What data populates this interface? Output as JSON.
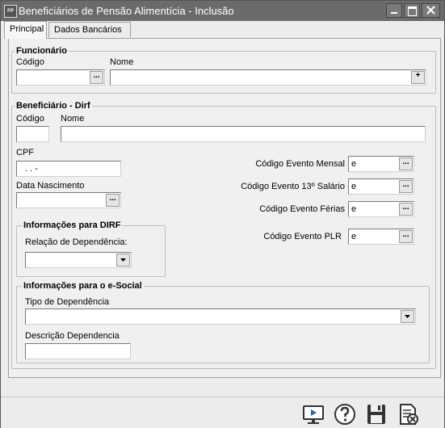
{
  "window": {
    "title": "Beneficiários de Pensão Alimentícia - Inclusão",
    "app_icon": "FP"
  },
  "tabs": [
    {
      "label": "Principal",
      "active": true
    },
    {
      "label": "Dados Bancários",
      "active": false
    }
  ],
  "funcionario": {
    "title": "Funcionário",
    "codigo_label": "Código",
    "nome_label": "Nome",
    "codigo_value": "",
    "nome_value": ""
  },
  "beneficiario": {
    "title": "Beneficiário - Dirf",
    "codigo_label": "Código",
    "nome_label": "Nome",
    "cpf_label": "CPF",
    "cpf_mask": ".   .   -",
    "nascimento_label": "Data Nascimento",
    "evento_mensal_label": "Código Evento Mensal",
    "evento_mensal_value": "e",
    "evento_13_label": "Código Evento 13º Salário",
    "evento_13_value": "e",
    "evento_ferias_label": "Código Evento Férias",
    "evento_ferias_value": "e",
    "evento_plr_label": "Código Evento PLR",
    "evento_plr_value": "e"
  },
  "dirf": {
    "title": "Informações para DIRF",
    "relacao_label": "Relação de Dependência:",
    "relacao_value": ""
  },
  "esocial": {
    "title": "Informações para o e-Social",
    "tipo_label": "Tipo de Dependência",
    "tipo_value": "",
    "descricao_label": "Descrição Dependencia",
    "descricao_value": ""
  },
  "ellipsis": "...",
  "plus": "+",
  "colors": {
    "titlebar": "#6b6b6b",
    "accent_blue": "#2d5fa8"
  },
  "toolbar_icons": [
    "monitor-icon",
    "help-icon",
    "save-icon",
    "cancel-document-icon"
  ]
}
